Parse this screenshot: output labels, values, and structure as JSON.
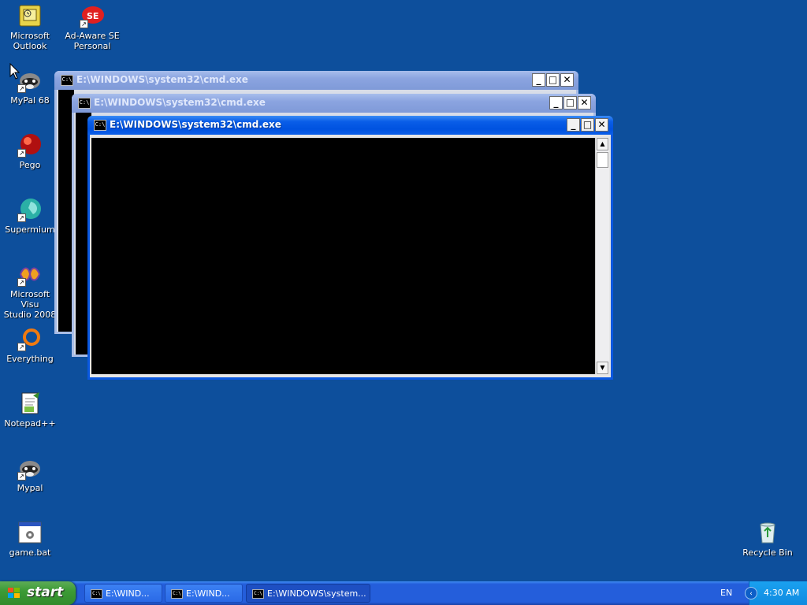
{
  "desktop": {
    "icons": [
      {
        "label": "Microsoft\nOutlook",
        "icon": "outlook-icon"
      },
      {
        "label": "Ad-Aware SE\nPersonal",
        "icon": "ad-aware-icon"
      },
      {
        "label": "MyPal 68",
        "icon": "raccoon-icon"
      },
      {
        "label": "Pego",
        "icon": "red-ball-icon"
      },
      {
        "label": "Supermium",
        "icon": "supermium-icon"
      },
      {
        "label": "Microsoft Visu\nStudio 2008",
        "icon": "visual-studio-icon"
      },
      {
        "label": "Everything",
        "icon": "everything-icon"
      },
      {
        "label": "Notepad++",
        "icon": "notepad-plus-plus-icon"
      },
      {
        "label": "Mypal",
        "icon": "raccoon-icon"
      },
      {
        "label": "game.bat",
        "icon": "batch-file-icon"
      },
      {
        "label": "Recycle Bin",
        "icon": "recycle-bin-icon"
      }
    ]
  },
  "windows": [
    {
      "title": "E:\\WINDOWS\\system32\\cmd.exe",
      "active": false
    },
    {
      "title": "E:\\WINDOWS\\system32\\cmd.exe",
      "active": false
    },
    {
      "title": "E:\\WINDOWS\\system32\\cmd.exe",
      "active": true
    }
  ],
  "window_buttons": {
    "minimize": "_",
    "maximize": "□",
    "close": "✕"
  },
  "cmd_icon_text": "C:\\",
  "taskbar": {
    "start_label": "start",
    "tasks": [
      {
        "label": "E:\\WIND..."
      },
      {
        "label": "E:\\WIND..."
      },
      {
        "label": "E:\\WINDOWS\\system..."
      }
    ],
    "language": "EN",
    "clock": "4:30 AM"
  },
  "colors": {
    "desktop": "#0d4f9c",
    "active_title": "#0a5ee8",
    "inactive_title": "#8ba4e0",
    "start_green": "#3c9b36",
    "tray_blue": "#0f8ae0"
  }
}
